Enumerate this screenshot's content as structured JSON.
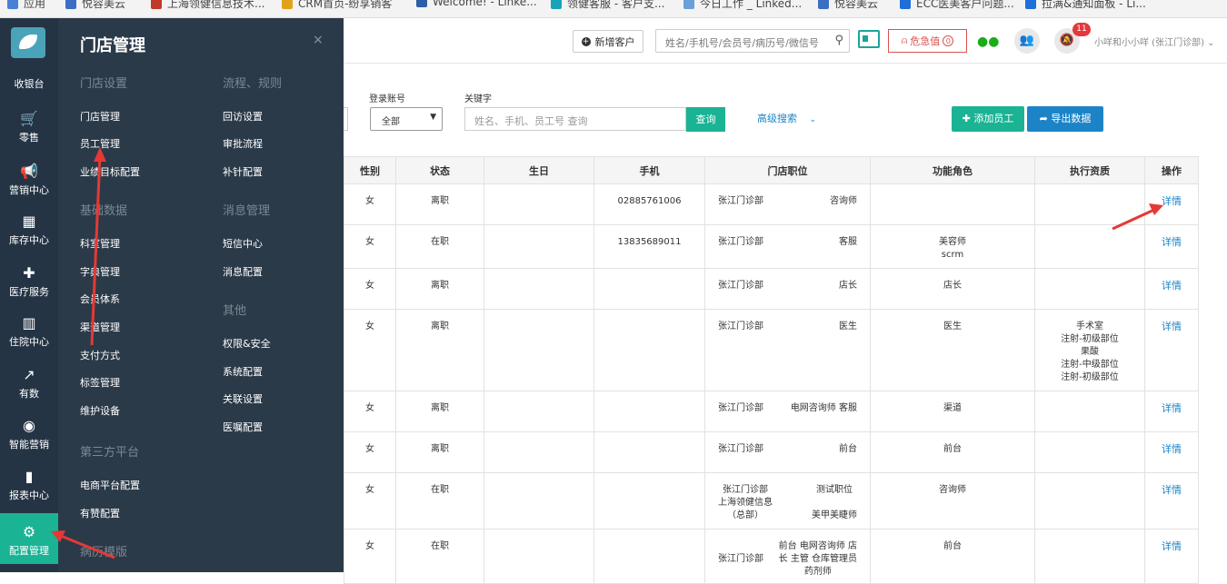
{
  "bookmarks": [
    {
      "label": "应用",
      "color": "#4a7fd6"
    },
    {
      "label": "悦容美云",
      "color": "#3b6fc4"
    },
    {
      "label": "上海领健信息技术...",
      "color": "#c0392b"
    },
    {
      "label": "CRM首页-纷享销客",
      "color": "#e0a21a"
    },
    {
      "label": "Welcome! - Linke...",
      "color": "#2a5ea8"
    },
    {
      "label": "领健客服 - 客户支...",
      "color": "#1aa3b8"
    },
    {
      "label": "今日工作 _ Linked...",
      "color": "#6aa0d8"
    },
    {
      "label": "悦容美云",
      "color": "#3b6fc4"
    },
    {
      "label": "ECC医美客户问题...",
      "color": "#1e6fd9"
    },
    {
      "label": "拉满&通知面板 - Li...",
      "color": "#1e6fd9"
    }
  ],
  "rail": {
    "items": [
      {
        "label": "收银台",
        "icon": "cashier-icon",
        "glyph": ""
      },
      {
        "label": "零售",
        "icon": "cart-icon",
        "glyph": "🛒"
      },
      {
        "label": "营销中心",
        "icon": "megaphone-icon",
        "glyph": "📢"
      },
      {
        "label": "库存中心",
        "icon": "grid-icon",
        "glyph": "▦"
      },
      {
        "label": "医疗服务",
        "icon": "medkit-icon",
        "glyph": "✚"
      },
      {
        "label": "住院中心",
        "icon": "building-icon",
        "glyph": "▥"
      },
      {
        "label": "有数",
        "icon": "trend-icon",
        "glyph": "↗"
      },
      {
        "label": "智能营销",
        "icon": "compass-icon",
        "glyph": "◉"
      },
      {
        "label": "报表中心",
        "icon": "bar-chart-icon",
        "glyph": "▮"
      },
      {
        "label": "配置管理",
        "icon": "gear-icon",
        "glyph": "⚙",
        "active": true
      }
    ],
    "accent": "#1ab394"
  },
  "panel": {
    "title": "门店管理",
    "close": "×",
    "col1": [
      {
        "type": "section",
        "label": "门店设置"
      },
      {
        "type": "link",
        "label": "门店管理"
      },
      {
        "type": "link",
        "label": "员工管理"
      },
      {
        "type": "link",
        "label": "业绩目标配置"
      },
      {
        "type": "section",
        "label": "基础数据"
      },
      {
        "type": "link",
        "label": "科室管理"
      },
      {
        "type": "link",
        "label": "字典管理"
      },
      {
        "type": "link",
        "label": "会员体系"
      },
      {
        "type": "link",
        "label": "渠道管理"
      },
      {
        "type": "link",
        "label": "支付方式"
      },
      {
        "type": "link",
        "label": "标签管理"
      },
      {
        "type": "link",
        "label": "维护设备"
      },
      {
        "type": "section",
        "label": "第三方平台"
      },
      {
        "type": "link",
        "label": "电商平台配置"
      },
      {
        "type": "link",
        "label": "有赞配置"
      },
      {
        "type": "section",
        "label": "病历模版"
      }
    ],
    "col2": [
      {
        "type": "section",
        "label": "流程、规则"
      },
      {
        "type": "link",
        "label": "回访设置"
      },
      {
        "type": "link",
        "label": "审批流程"
      },
      {
        "type": "link",
        "label": "补针配置"
      },
      {
        "type": "section",
        "label": "消息管理"
      },
      {
        "type": "link",
        "label": "短信中心"
      },
      {
        "type": "link",
        "label": "消息配置"
      },
      {
        "type": "section",
        "label": "其他"
      },
      {
        "type": "link",
        "label": "权限&安全"
      },
      {
        "type": "link",
        "label": "系统配置"
      },
      {
        "type": "link",
        "label": "关联设置"
      },
      {
        "type": "link",
        "label": "医嘱配置"
      }
    ]
  },
  "topbar": {
    "new_customer": "新增客户",
    "search_placeholder": "姓名/手机号/会员号/病历号/微信号",
    "critical": "危急值",
    "critical_count": "0",
    "badge": "11",
    "user": "小咩和小小咩 (张江门诊部)"
  },
  "filters": {
    "account_label": "登录账号",
    "account_value": "全部",
    "keyword_label": "关键字",
    "keyword_placeholder": "姓名、手机、员工号 查询",
    "query": "查询",
    "advanced": "高级搜索",
    "add_employee": "添加员工",
    "export": "导出数据"
  },
  "table": {
    "headers": [
      "性别",
      "状态",
      "生日",
      "手机",
      "门店职位",
      "功能角色",
      "执行资质",
      "操作"
    ],
    "rows": [
      {
        "gender": "女",
        "status": "离职",
        "birthday": "",
        "phone": "02885761006",
        "store": [
          "张江门诊部"
        ],
        "position": [
          "咨询师"
        ],
        "role": [],
        "qual": [],
        "action": "详情"
      },
      {
        "gender": "女",
        "status": "在职",
        "birthday": "",
        "phone": "13835689011",
        "store": [
          "张江门诊部"
        ],
        "position": [
          "客服"
        ],
        "role": [
          "美容师",
          "scrm"
        ],
        "qual": [],
        "action": "详情"
      },
      {
        "gender": "女",
        "status": "离职",
        "birthday": "",
        "phone": "",
        "store": [
          "张江门诊部"
        ],
        "position": [
          "店长"
        ],
        "role": [
          "店长"
        ],
        "qual": [],
        "action": "详情"
      },
      {
        "gender": "女",
        "status": "离职",
        "birthday": "",
        "phone": "",
        "store": [
          "张江门诊部"
        ],
        "position": [
          "医生"
        ],
        "role": [
          "医生"
        ],
        "qual": [
          "手术室",
          "注射-初级部位",
          "果酸",
          "注射-中级部位",
          "注射-初级部位"
        ],
        "action": "详情"
      },
      {
        "gender": "女",
        "status": "离职",
        "birthday": "",
        "phone": "",
        "store": [
          "张江门诊部"
        ],
        "position": [
          "电网咨询师 客服"
        ],
        "role": [
          "渠道"
        ],
        "qual": [],
        "action": "详情"
      },
      {
        "gender": "女",
        "status": "离职",
        "birthday": "",
        "phone": "",
        "store": [
          "张江门诊部"
        ],
        "position": [
          "前台"
        ],
        "role": [
          "前台"
        ],
        "qual": [],
        "action": "详情"
      },
      {
        "gender": "女",
        "status": "在职",
        "birthday": "",
        "phone": "",
        "store": [
          "张江门诊部",
          "上海领健信息",
          "（总部）"
        ],
        "position": [
          "测试职位",
          "",
          "美甲美睫师"
        ],
        "role": [
          "咨询师"
        ],
        "qual": [],
        "action": "详情"
      },
      {
        "gender": "女",
        "status": "在职",
        "birthday": "",
        "phone": "",
        "store": [
          "",
          "张江门诊部"
        ],
        "position": [
          "前台  电网咨询师  店",
          "长  主管  仓库管理员",
          "药剂师"
        ],
        "role": [
          "前台"
        ],
        "qual": [],
        "action": "详情"
      }
    ],
    "row_heights": [
      45,
      48,
      45,
      90,
      45,
      45,
      62,
      60
    ]
  }
}
